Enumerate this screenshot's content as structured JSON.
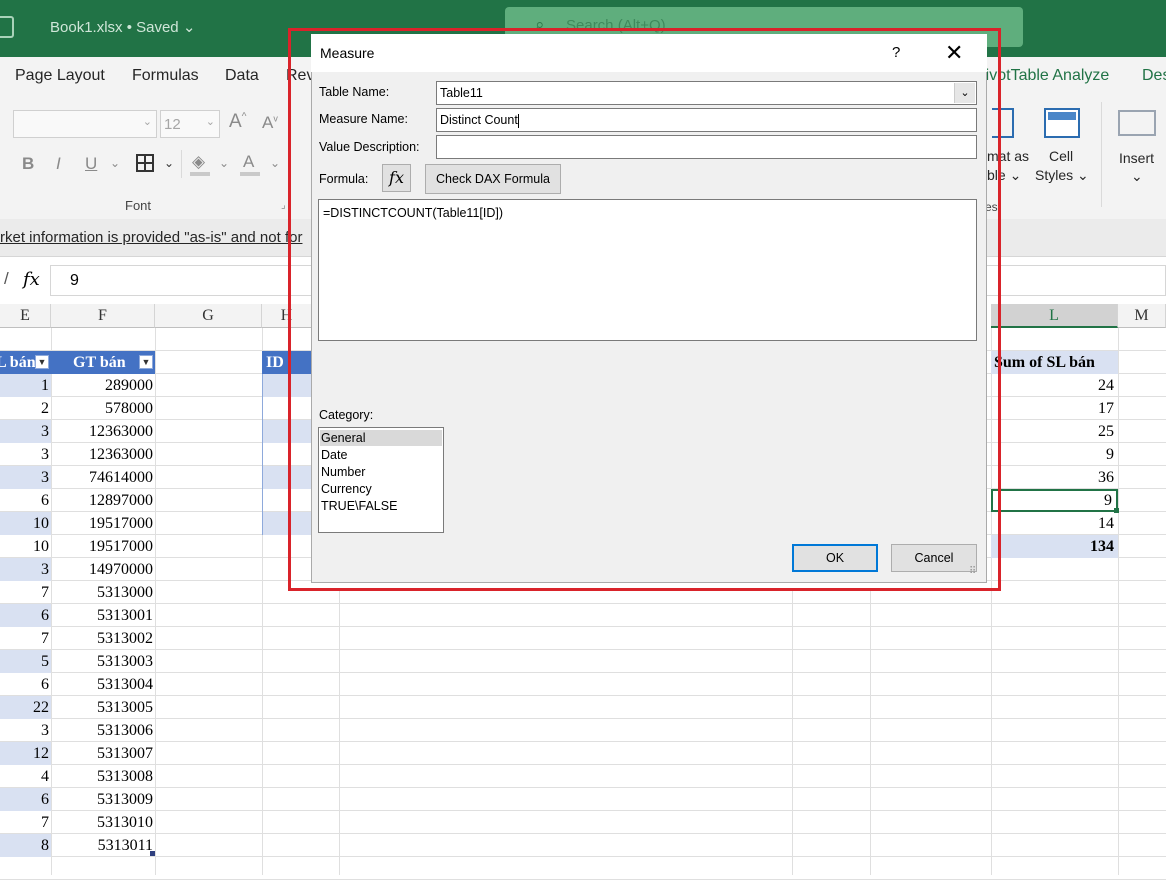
{
  "window": {
    "title": "Book1.xlsx • Saved",
    "title_chevron": "⌄",
    "search_placeholder": "Search (Alt+Q)"
  },
  "tabs": [
    "Page Layout",
    "Formulas",
    "Data",
    "Rev",
    "PivotTable Analyze",
    "Des"
  ],
  "ribbon": {
    "font_size": "12",
    "grow_font": "A",
    "shrink_font": "A",
    "bold": "B",
    "italic": "I",
    "underline": "U",
    "font_color": "A",
    "font_group_label": "Font",
    "format_as_table_line1": "mat as",
    "format_as_table_line2": "ble ⌄",
    "cell_styles_line1": "Cell",
    "cell_styles_line2": "Styles ⌄",
    "styles_group_label": "es",
    "insert_label": "Insert",
    "insert_chevron": "⌄"
  },
  "message_bar": {
    "text": "rket information is provided \"as-is\" and not for"
  },
  "formula_bar": {
    "fx": "fx",
    "value": "9"
  },
  "columns": [
    "E",
    "F",
    "G",
    "H",
    "L",
    "M"
  ],
  "table": {
    "header_e": "L bán",
    "header_f": "GT bán",
    "e_values": [
      "1",
      "2",
      "3",
      "3",
      "3",
      "6",
      "10",
      "10",
      "3",
      "7",
      "6",
      "7",
      "5",
      "6",
      "22",
      "3",
      "12",
      "4",
      "6",
      "7",
      "8"
    ],
    "f_values": [
      "289000",
      "578000",
      "12363000",
      "12363000",
      "74614000",
      "12897000",
      "19517000",
      "19517000",
      "14970000",
      "5313000",
      "5313001",
      "5313002",
      "5313003",
      "5313004",
      "5313005",
      "5313006",
      "5313007",
      "5313008",
      "5313009",
      "5313010",
      "5313011"
    ]
  },
  "table2": {
    "header": "ID"
  },
  "pivot": {
    "header": "Sum of SL bán",
    "values": [
      "24",
      "17",
      "25",
      "9",
      "36",
      "9",
      "14"
    ],
    "total": "134"
  },
  "dialog": {
    "title": "Measure",
    "help": "?",
    "close": "✕",
    "table_name_label": "Table Name:",
    "table_name_value": "Table11",
    "measure_name_label": "Measure Name:",
    "measure_name_value": "Distinct Count",
    "value_description_label": "Value Description:",
    "value_description_value": "",
    "formula_label": "Formula:",
    "fx_button": "fx",
    "check_dax_label": "Check DAX Formula",
    "formula_text": "=DISTINCTCOUNT(Table11[ID])",
    "category_label": "Category:",
    "categories": [
      "General",
      "Date",
      "Number",
      "Currency",
      "TRUE\\FALSE"
    ],
    "selected_category": "General",
    "ok_label": "OK",
    "cancel_label": "Cancel"
  },
  "colors": {
    "excel_green": "#217346",
    "table_blue": "#4472c4",
    "band_blue": "#d9e1f2",
    "highlight_red": "#d9232a"
  }
}
